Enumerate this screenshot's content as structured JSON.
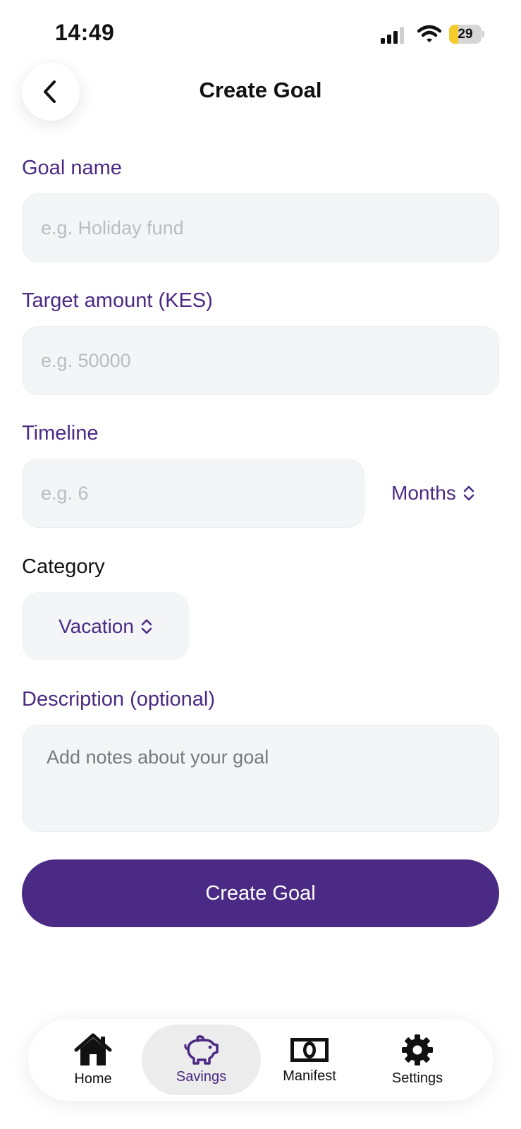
{
  "status_bar": {
    "time": "14:49",
    "battery": "29",
    "battery_level": 0.29
  },
  "header": {
    "title": "Create Goal"
  },
  "form": {
    "goal_name": {
      "label": "Goal name",
      "placeholder": "e.g. Holiday fund",
      "value": ""
    },
    "target_amount": {
      "label": "Target amount (KES)",
      "placeholder": "e.g. 50000",
      "value": ""
    },
    "timeline": {
      "label": "Timeline",
      "placeholder": "e.g. 6",
      "value": "",
      "unit": "Months"
    },
    "category": {
      "label": "Category",
      "value": "Vacation"
    },
    "description": {
      "label": "Description (optional)",
      "placeholder": "Add notes about your goal",
      "value": ""
    },
    "submit_label": "Create Goal"
  },
  "tab_bar": {
    "active": "Savings",
    "items": [
      {
        "label": "Home",
        "icon": "home-icon"
      },
      {
        "label": "Savings",
        "icon": "piggy-bank-icon"
      },
      {
        "label": "Manifest",
        "icon": "banknote-icon"
      },
      {
        "label": "Settings",
        "icon": "gear-icon"
      }
    ]
  },
  "colors": {
    "accent": "#4a2a84",
    "label": "#4b2a83",
    "field_bg": "#f4f5f7",
    "battery": "#f5cc2c"
  }
}
